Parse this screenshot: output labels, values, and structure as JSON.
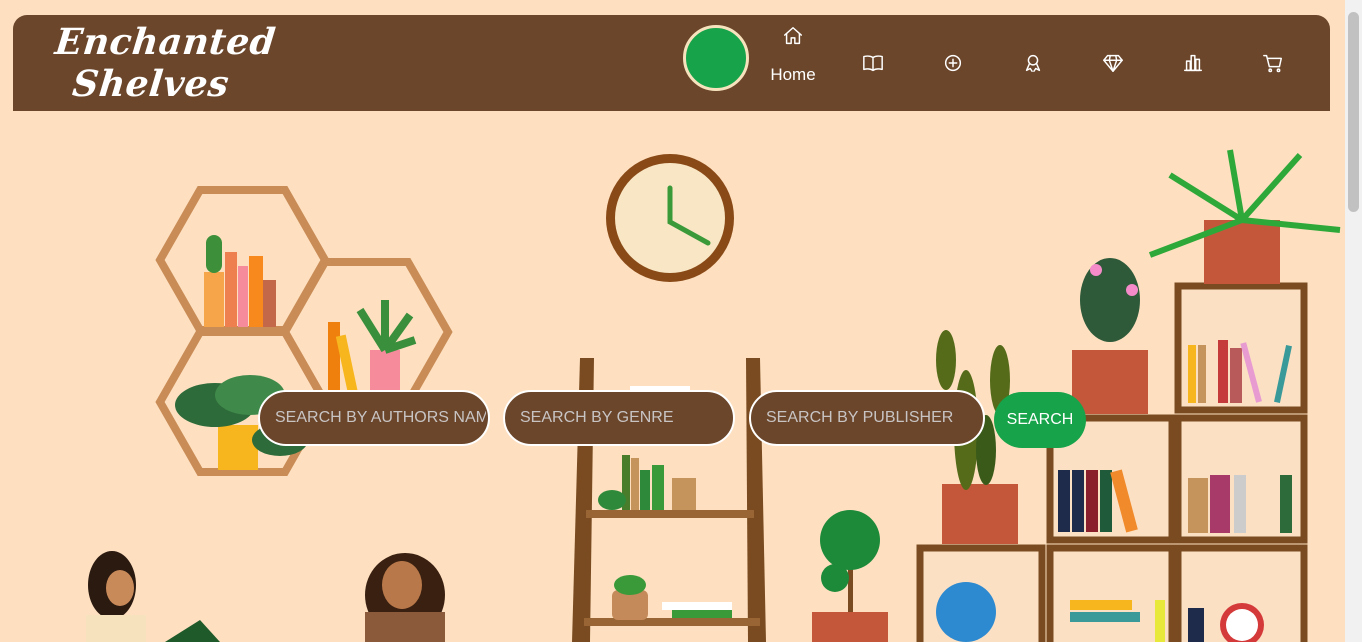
{
  "brand": {
    "line1": "Enchanted",
    "line2": "Shelves"
  },
  "nav": {
    "home_label": "Home",
    "items": [
      {
        "icon": "home-icon"
      },
      {
        "icon": "book-open-icon"
      },
      {
        "icon": "plus-circle-icon"
      },
      {
        "icon": "award-icon"
      },
      {
        "icon": "diamond-icon"
      },
      {
        "icon": "bar-chart-icon"
      },
      {
        "icon": "cart-icon"
      }
    ]
  },
  "search": {
    "author_placeholder": "SEARCH BY AUTHORS NAME",
    "genre_placeholder": "SEARCH BY GENRE",
    "publisher_placeholder": "SEARCH BY PUBLISHER",
    "button_label": "SEARCH"
  },
  "colors": {
    "background": "#fee0c0",
    "nav": "#6b462b",
    "accent": "#17a34a"
  }
}
